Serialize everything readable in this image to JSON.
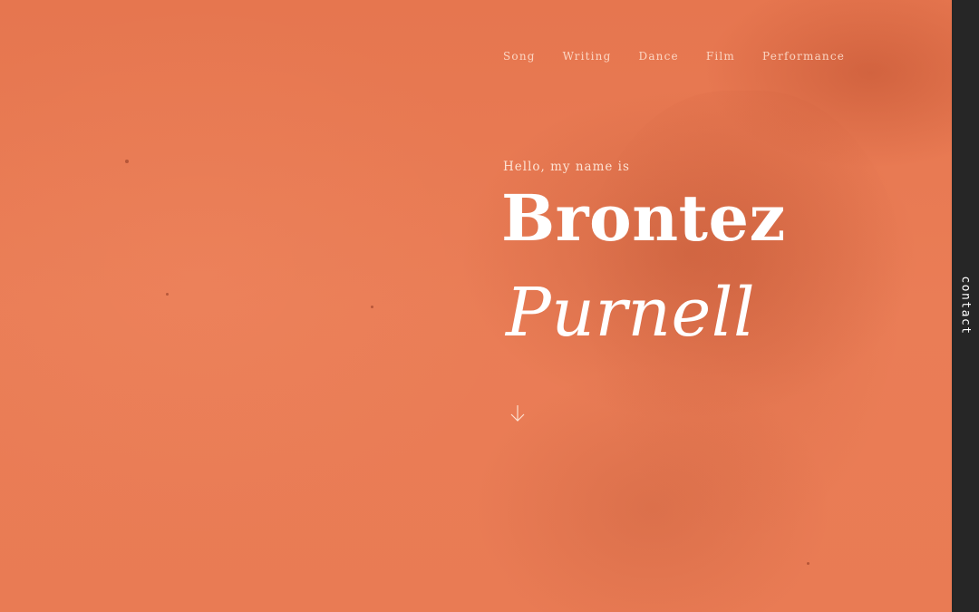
{
  "nav": {
    "items": [
      {
        "label": "Song"
      },
      {
        "label": "Writing"
      },
      {
        "label": "Dance"
      },
      {
        "label": "Film"
      },
      {
        "label": "Performance"
      }
    ]
  },
  "hero": {
    "greeting": "Hello, my name is",
    "first_name": "Brontez",
    "last_name": "Purnell",
    "scroll_icon": "arrow-down-icon"
  },
  "sidebar": {
    "contact_label": "contact"
  },
  "colors": {
    "accent": "#e87a55",
    "sidebar": "#262626",
    "text": "#ffffff"
  }
}
